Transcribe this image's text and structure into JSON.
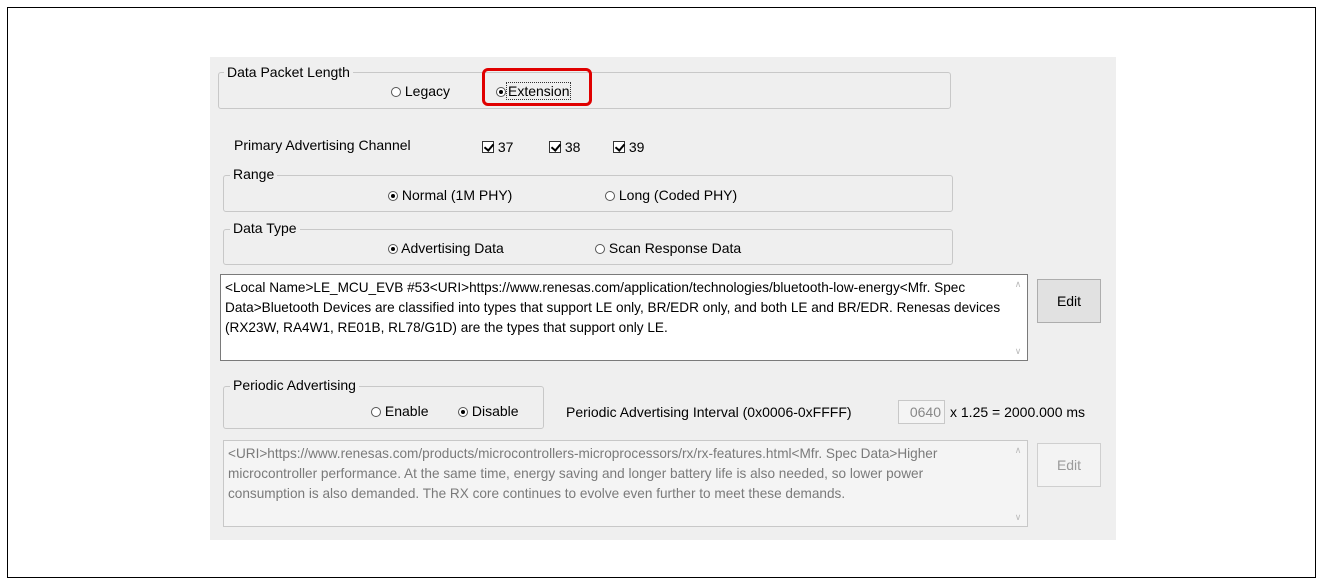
{
  "data_packet_length": {
    "legend": "Data Packet Length",
    "options": [
      {
        "label": "Legacy",
        "selected": false
      },
      {
        "label": "Extension",
        "selected": true
      }
    ]
  },
  "primary_advertising_channel": {
    "label": "Primary Advertising Channel",
    "channels": [
      {
        "label": "37",
        "checked": true
      },
      {
        "label": "38",
        "checked": true
      },
      {
        "label": "39",
        "checked": true
      }
    ]
  },
  "range": {
    "legend": "Range",
    "options": [
      {
        "label": "Normal (1M PHY)",
        "selected": true
      },
      {
        "label": "Long (Coded PHY)",
        "selected": false
      }
    ]
  },
  "data_type": {
    "legend": "Data Type",
    "options": [
      {
        "label": "Advertising Data",
        "selected": true
      },
      {
        "label": "Scan Response Data",
        "selected": false
      }
    ]
  },
  "advertising_data_text": "<Local Name>LE_MCU_EVB #53<URI>https://www.renesas.com/application/technologies/bluetooth-low-energy<Mfr. Spec Data>Bluetooth Devices are classified into types that support LE only, BR/EDR only, and both LE and BR/EDR. Renesas devices (RX23W, RA4W1, RE01B, RL78/G1D) are the types that support only LE.",
  "edit_button_label": "Edit",
  "periodic_advertising": {
    "legend": "Periodic Advertising",
    "options": [
      {
        "label": "Enable",
        "selected": false
      },
      {
        "label": "Disable",
        "selected": true
      }
    ],
    "interval_label": "Periodic Advertising Interval (0x0006-0xFFFF)",
    "interval_value": "0640",
    "interval_suffix": "x 1.25 =  2000.000 ms",
    "data_text": "<URI>https://www.renesas.com/products/microcontrollers-microprocessors/rx/rx-features.html<Mfr. Spec Data>Higher microcontroller performance. At the same time, energy saving and longer battery life is also needed, so lower power consumption is also demanded. The RX core continues to evolve even further to meet these demands.",
    "edit_button_label": "Edit"
  },
  "colors": {
    "panel_background": "#efefef",
    "highlight": "#e00000"
  }
}
